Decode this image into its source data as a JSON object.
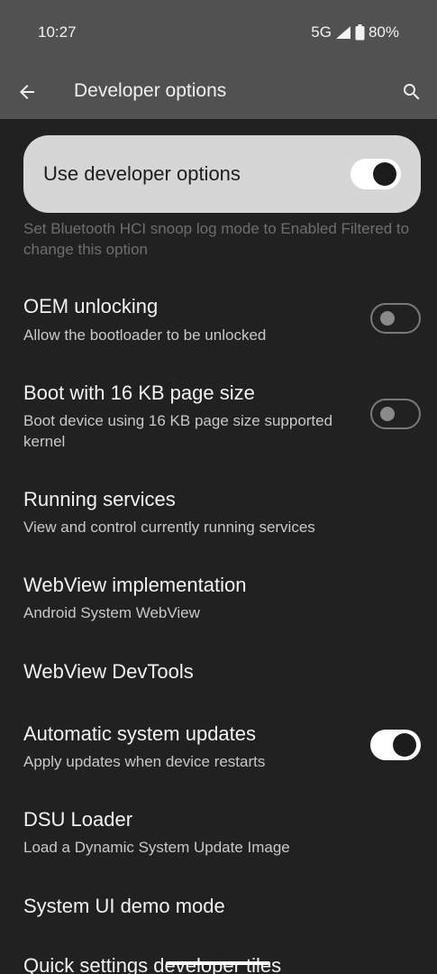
{
  "status_bar": {
    "time": "10:27",
    "network": "5G",
    "battery": "80%"
  },
  "app_bar": {
    "title": "Developer options"
  },
  "master_switch": {
    "label": "Use developer options",
    "checked": true
  },
  "disabled_summary": "Set Bluetooth HCI snoop log mode to Enabled Filtered to change this option",
  "settings": [
    {
      "title": "OEM unlocking",
      "summary": "Allow the bootloader to be unlocked",
      "toggle": "off"
    },
    {
      "title": "Boot with 16 KB page size",
      "summary": "Boot device using 16 KB page size supported kernel",
      "toggle": "off"
    },
    {
      "title": "Running services",
      "summary": "View and control currently running services",
      "toggle": null
    },
    {
      "title": "WebView implementation",
      "summary": "Android System WebView",
      "toggle": null
    },
    {
      "title": "WebView DevTools",
      "summary": "",
      "toggle": null
    },
    {
      "title": "Automatic system updates",
      "summary": "Apply updates when device restarts",
      "toggle": "on"
    },
    {
      "title": "DSU Loader",
      "summary": "Load a Dynamic System Update Image",
      "toggle": null
    },
    {
      "title": "System UI demo mode",
      "summary": "",
      "toggle": null
    },
    {
      "title": "Quick settings developer tiles",
      "summary": "",
      "toggle": null
    }
  ],
  "colors": {
    "background": "#212121",
    "app_bar": "#515151",
    "master_card": "#d6d6d6"
  }
}
